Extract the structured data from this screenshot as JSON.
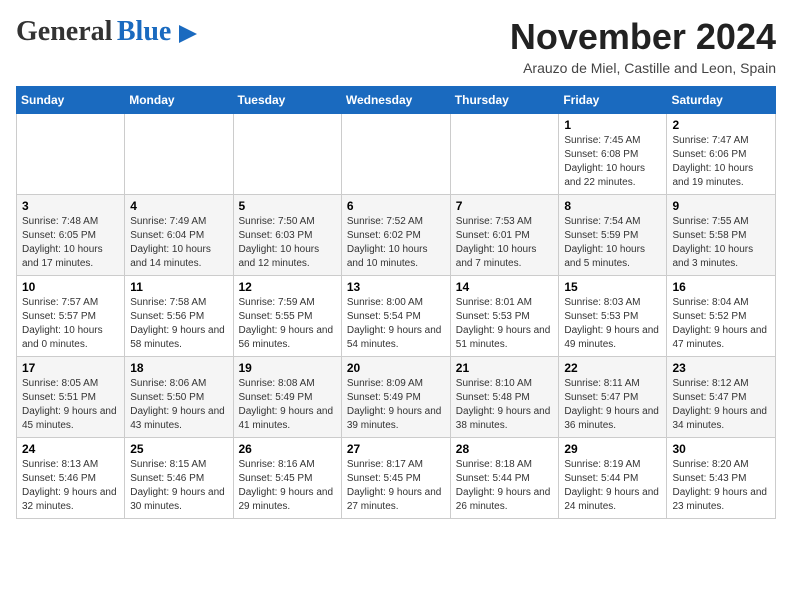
{
  "header": {
    "logo_general": "General",
    "logo_blue": "Blue",
    "month_title": "November 2024",
    "subtitle": "Arauzo de Miel, Castille and Leon, Spain"
  },
  "weekdays": [
    "Sunday",
    "Monday",
    "Tuesday",
    "Wednesday",
    "Thursday",
    "Friday",
    "Saturday"
  ],
  "weeks": [
    [
      {
        "day": "",
        "content": ""
      },
      {
        "day": "",
        "content": ""
      },
      {
        "day": "",
        "content": ""
      },
      {
        "day": "",
        "content": ""
      },
      {
        "day": "",
        "content": ""
      },
      {
        "day": "1",
        "content": "Sunrise: 7:45 AM\nSunset: 6:08 PM\nDaylight: 10 hours and 22 minutes."
      },
      {
        "day": "2",
        "content": "Sunrise: 7:47 AM\nSunset: 6:06 PM\nDaylight: 10 hours and 19 minutes."
      }
    ],
    [
      {
        "day": "3",
        "content": "Sunrise: 7:48 AM\nSunset: 6:05 PM\nDaylight: 10 hours and 17 minutes."
      },
      {
        "day": "4",
        "content": "Sunrise: 7:49 AM\nSunset: 6:04 PM\nDaylight: 10 hours and 14 minutes."
      },
      {
        "day": "5",
        "content": "Sunrise: 7:50 AM\nSunset: 6:03 PM\nDaylight: 10 hours and 12 minutes."
      },
      {
        "day": "6",
        "content": "Sunrise: 7:52 AM\nSunset: 6:02 PM\nDaylight: 10 hours and 10 minutes."
      },
      {
        "day": "7",
        "content": "Sunrise: 7:53 AM\nSunset: 6:01 PM\nDaylight: 10 hours and 7 minutes."
      },
      {
        "day": "8",
        "content": "Sunrise: 7:54 AM\nSunset: 5:59 PM\nDaylight: 10 hours and 5 minutes."
      },
      {
        "day": "9",
        "content": "Sunrise: 7:55 AM\nSunset: 5:58 PM\nDaylight: 10 hours and 3 minutes."
      }
    ],
    [
      {
        "day": "10",
        "content": "Sunrise: 7:57 AM\nSunset: 5:57 PM\nDaylight: 10 hours and 0 minutes."
      },
      {
        "day": "11",
        "content": "Sunrise: 7:58 AM\nSunset: 5:56 PM\nDaylight: 9 hours and 58 minutes."
      },
      {
        "day": "12",
        "content": "Sunrise: 7:59 AM\nSunset: 5:55 PM\nDaylight: 9 hours and 56 minutes."
      },
      {
        "day": "13",
        "content": "Sunrise: 8:00 AM\nSunset: 5:54 PM\nDaylight: 9 hours and 54 minutes."
      },
      {
        "day": "14",
        "content": "Sunrise: 8:01 AM\nSunset: 5:53 PM\nDaylight: 9 hours and 51 minutes."
      },
      {
        "day": "15",
        "content": "Sunrise: 8:03 AM\nSunset: 5:53 PM\nDaylight: 9 hours and 49 minutes."
      },
      {
        "day": "16",
        "content": "Sunrise: 8:04 AM\nSunset: 5:52 PM\nDaylight: 9 hours and 47 minutes."
      }
    ],
    [
      {
        "day": "17",
        "content": "Sunrise: 8:05 AM\nSunset: 5:51 PM\nDaylight: 9 hours and 45 minutes."
      },
      {
        "day": "18",
        "content": "Sunrise: 8:06 AM\nSunset: 5:50 PM\nDaylight: 9 hours and 43 minutes."
      },
      {
        "day": "19",
        "content": "Sunrise: 8:08 AM\nSunset: 5:49 PM\nDaylight: 9 hours and 41 minutes."
      },
      {
        "day": "20",
        "content": "Sunrise: 8:09 AM\nSunset: 5:49 PM\nDaylight: 9 hours and 39 minutes."
      },
      {
        "day": "21",
        "content": "Sunrise: 8:10 AM\nSunset: 5:48 PM\nDaylight: 9 hours and 38 minutes."
      },
      {
        "day": "22",
        "content": "Sunrise: 8:11 AM\nSunset: 5:47 PM\nDaylight: 9 hours and 36 minutes."
      },
      {
        "day": "23",
        "content": "Sunrise: 8:12 AM\nSunset: 5:47 PM\nDaylight: 9 hours and 34 minutes."
      }
    ],
    [
      {
        "day": "24",
        "content": "Sunrise: 8:13 AM\nSunset: 5:46 PM\nDaylight: 9 hours and 32 minutes."
      },
      {
        "day": "25",
        "content": "Sunrise: 8:15 AM\nSunset: 5:46 PM\nDaylight: 9 hours and 30 minutes."
      },
      {
        "day": "26",
        "content": "Sunrise: 8:16 AM\nSunset: 5:45 PM\nDaylight: 9 hours and 29 minutes."
      },
      {
        "day": "27",
        "content": "Sunrise: 8:17 AM\nSunset: 5:45 PM\nDaylight: 9 hours and 27 minutes."
      },
      {
        "day": "28",
        "content": "Sunrise: 8:18 AM\nSunset: 5:44 PM\nDaylight: 9 hours and 26 minutes."
      },
      {
        "day": "29",
        "content": "Sunrise: 8:19 AM\nSunset: 5:44 PM\nDaylight: 9 hours and 24 minutes."
      },
      {
        "day": "30",
        "content": "Sunrise: 8:20 AM\nSunset: 5:43 PM\nDaylight: 9 hours and 23 minutes."
      }
    ]
  ]
}
